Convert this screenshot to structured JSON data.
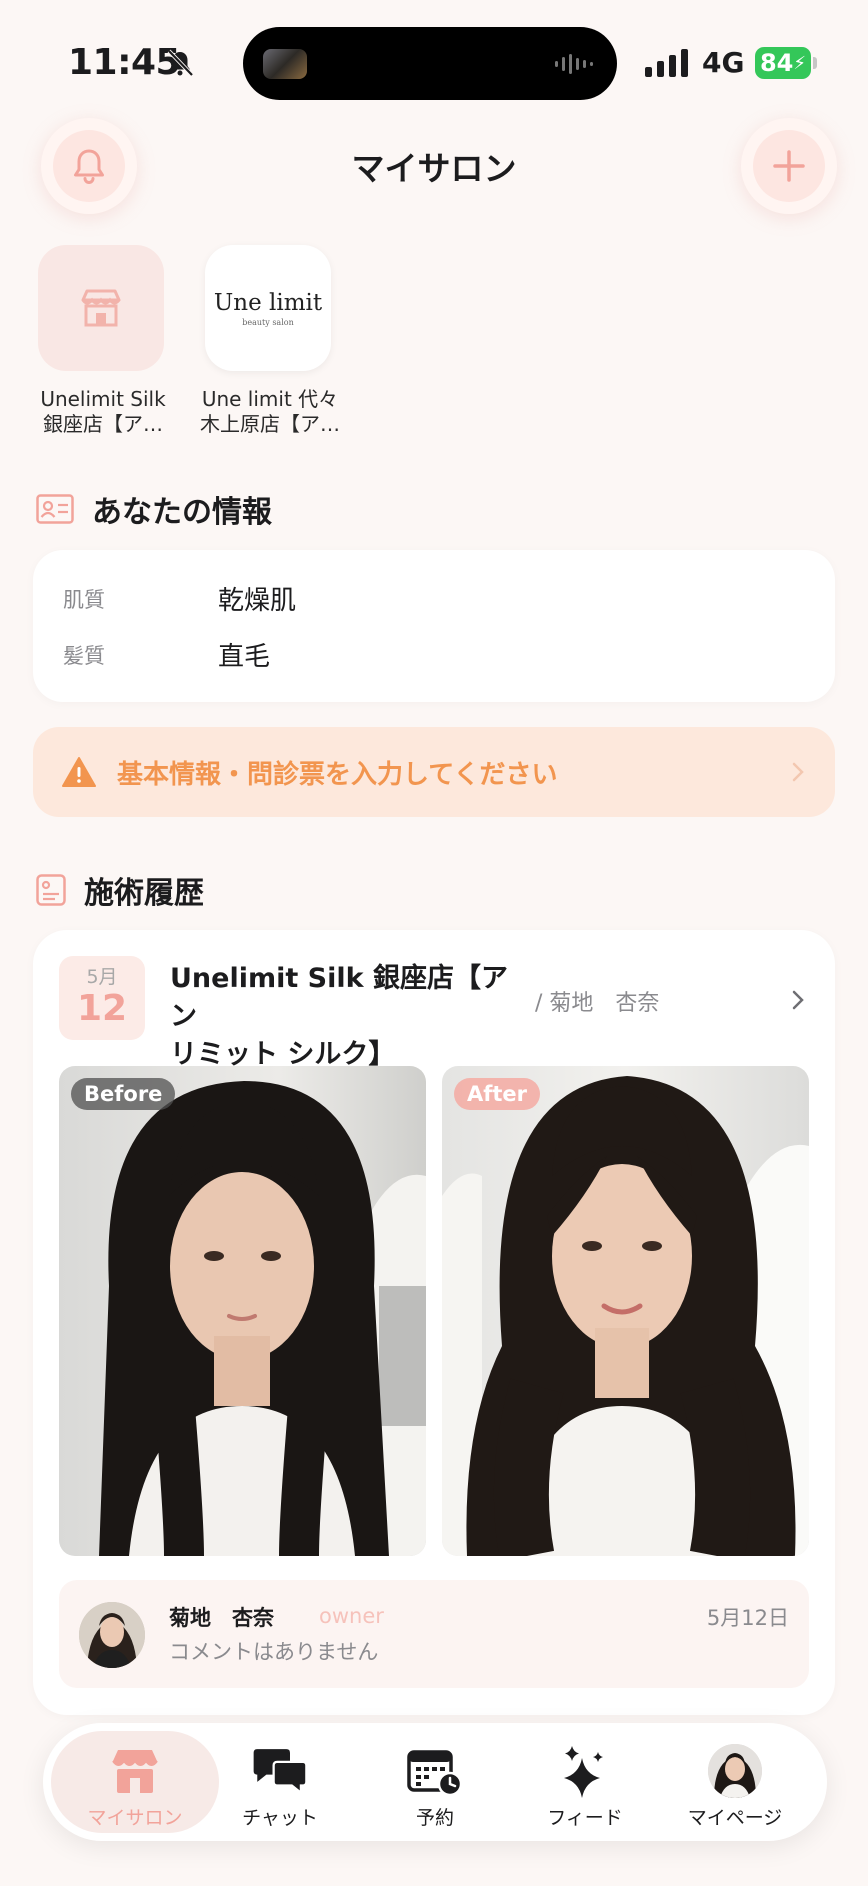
{
  "status_bar": {
    "time": "11:45",
    "network": "4G",
    "battery": "84",
    "icons": [
      "bell-slash-icon",
      "signal-icon",
      "battery-charging-icon"
    ]
  },
  "header": {
    "title": "マイサロン",
    "left_icon": "bell-icon",
    "right_icon": "plus-icon"
  },
  "salons": [
    {
      "name_line1": "Unelimit Silk",
      "name_line2": "銀座店【ア…",
      "icon": "store-icon"
    },
    {
      "name_line1": "Une limit 代々",
      "name_line2": "木上原店【ア…",
      "logo_main": "Une limit",
      "logo_sub": "beauty salon"
    }
  ],
  "profile": {
    "title": "あなたの情報",
    "icon": "id-card-icon",
    "rows": [
      {
        "label": "肌質",
        "value": "乾燥肌"
      },
      {
        "label": "髪質",
        "value": "直毛"
      }
    ]
  },
  "alert": {
    "text": "基本情報・問診票を入力してください",
    "icon": "warning-icon",
    "color": "#f2954f"
  },
  "history": {
    "title": "施術履歴",
    "icon": "history-icon",
    "visit": {
      "month": "5月",
      "day": "12",
      "salon_line1": "Unelimit Silk 銀座店【アン",
      "salon_line2": "リミット シルク】",
      "staff": "/ 菊地　杏奈",
      "before_label": "Before",
      "after_label": "After",
      "comment": {
        "name": "菊地　杏奈",
        "role": "owner",
        "date": "5月12日",
        "text": "コメントはありません"
      }
    }
  },
  "tabs": [
    {
      "label": "マイサロン",
      "icon": "store-icon",
      "active": true
    },
    {
      "label": "チャット",
      "icon": "chat-bubbles-icon",
      "active": false
    },
    {
      "label": "予約",
      "icon": "calendar-clock-icon",
      "active": false
    },
    {
      "label": "フィード",
      "icon": "sparkles-icon",
      "active": false
    },
    {
      "label": "マイページ",
      "icon": "avatar",
      "active": false
    }
  ],
  "colors": {
    "accent": "#f2a39a",
    "background": "#fcf7f5",
    "alert_bg": "#fde8dc"
  }
}
